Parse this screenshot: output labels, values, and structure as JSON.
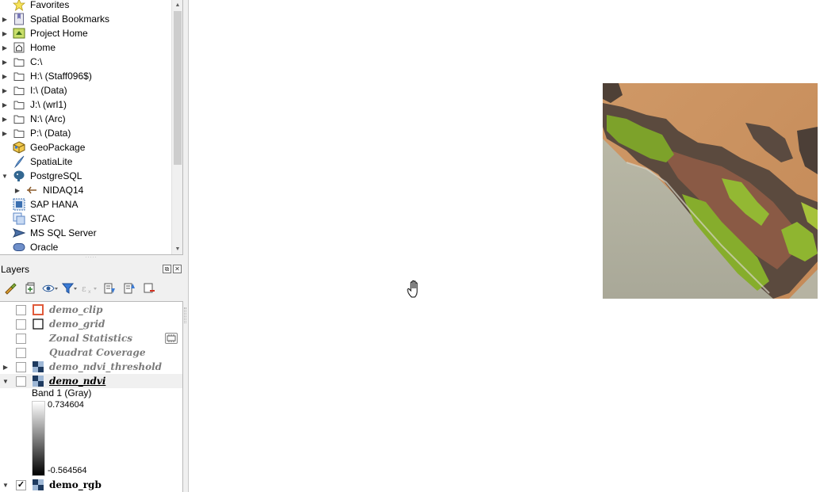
{
  "browser": {
    "items": [
      {
        "label": "Favorites",
        "icon": "star-icon",
        "expand": ""
      },
      {
        "label": "Spatial Bookmarks",
        "icon": "bookmark-icon",
        "expand": "right"
      },
      {
        "label": "Project Home",
        "icon": "project-home-icon",
        "expand": "right"
      },
      {
        "label": "Home",
        "icon": "home-folder-icon",
        "expand": "right"
      },
      {
        "label": "C:\\",
        "icon": "folder-icon",
        "expand": "right"
      },
      {
        "label": "H:\\ (Staff096$)",
        "icon": "folder-icon",
        "expand": "right"
      },
      {
        "label": "I:\\ (Data)",
        "icon": "folder-icon",
        "expand": "right"
      },
      {
        "label": "J:\\ (wrl1)",
        "icon": "folder-icon",
        "expand": "right"
      },
      {
        "label": "N:\\ (Arc)",
        "icon": "folder-icon",
        "expand": "right"
      },
      {
        "label": "P:\\ (Data)",
        "icon": "folder-icon",
        "expand": "right"
      },
      {
        "label": "GeoPackage",
        "icon": "geopackage-icon",
        "expand": ""
      },
      {
        "label": "SpatiaLite",
        "icon": "spatialite-icon",
        "expand": ""
      },
      {
        "label": "PostgreSQL",
        "icon": "postgresql-icon",
        "expand": "down"
      },
      {
        "label": "NIDAQ14",
        "icon": "connection-icon",
        "expand": "right"
      },
      {
        "label": "SAP HANA",
        "icon": "sap-hana-icon",
        "expand": ""
      },
      {
        "label": "STAC",
        "icon": "stac-icon",
        "expand": ""
      },
      {
        "label": "MS SQL Server",
        "icon": "mssql-icon",
        "expand": ""
      },
      {
        "label": "Oracle",
        "icon": "oracle-icon",
        "expand": ""
      }
    ]
  },
  "layers_panel": {
    "title": "Layers",
    "float_button": "⧉",
    "close_button": "✕",
    "layers": [
      {
        "name": "demo_clip",
        "checked": false,
        "symbol": "polygon-red-outline-icon"
      },
      {
        "name": "demo_grid",
        "checked": false,
        "symbol": "polygon-black-outline-icon"
      },
      {
        "name": "Zonal Statistics",
        "checked": false,
        "symbol": ""
      },
      {
        "name": "Quadrat Coverage",
        "checked": false,
        "symbol": ""
      },
      {
        "name": "demo_ndvi_threshold",
        "checked": false,
        "symbol": "raster-icon"
      },
      {
        "name": "demo_ndvi",
        "checked": false,
        "symbol": "raster-icon"
      },
      {
        "name": "demo_rgb",
        "checked": true,
        "symbol": "raster-icon"
      }
    ],
    "band_label": "Band 1 (Gray)",
    "ramp_max": "0.734604",
    "ramp_min": "-0.564564",
    "check_mark": "✓"
  },
  "colors": {
    "accent_red": "#e05a3a",
    "selection_bg": "#f0f0f0",
    "panel_bg": "#f0f0f0"
  }
}
